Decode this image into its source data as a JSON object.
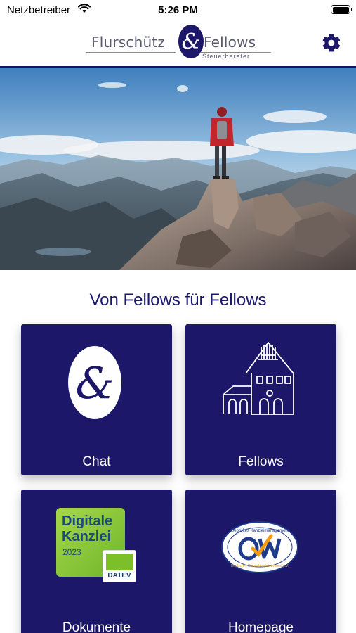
{
  "status_bar": {
    "carrier": "Netzbetreiber",
    "time": "5:26 PM"
  },
  "header": {
    "logo_left": "Flurschütz",
    "logo_right": "Fellows",
    "logo_sub": "Steuerberater",
    "settings_icon": "gear-icon"
  },
  "main": {
    "title": "Von Fellows für Fellows",
    "tiles": [
      {
        "label": "Chat",
        "icon": "ampersand-logo-icon"
      },
      {
        "label": "Fellows",
        "icon": "building-icon"
      },
      {
        "label": "Dokumente",
        "icon": "digitale-kanzlei-badge",
        "badge": {
          "line1": "Digitale",
          "line2": "Kanzlei",
          "year": "2023",
          "brand": "DATEV"
        }
      },
      {
        "label": "Homepage",
        "icon": "qm-seal-icon",
        "seal": {
          "top": "Geprüftes Kanzleimanagement",
          "bottom": "Deutscher Steuerberaterverband e.V."
        }
      }
    ]
  },
  "colors": {
    "brand_navy": "#1c1769",
    "title_blue": "#1b1870",
    "datev_green": "#7cbf29"
  }
}
